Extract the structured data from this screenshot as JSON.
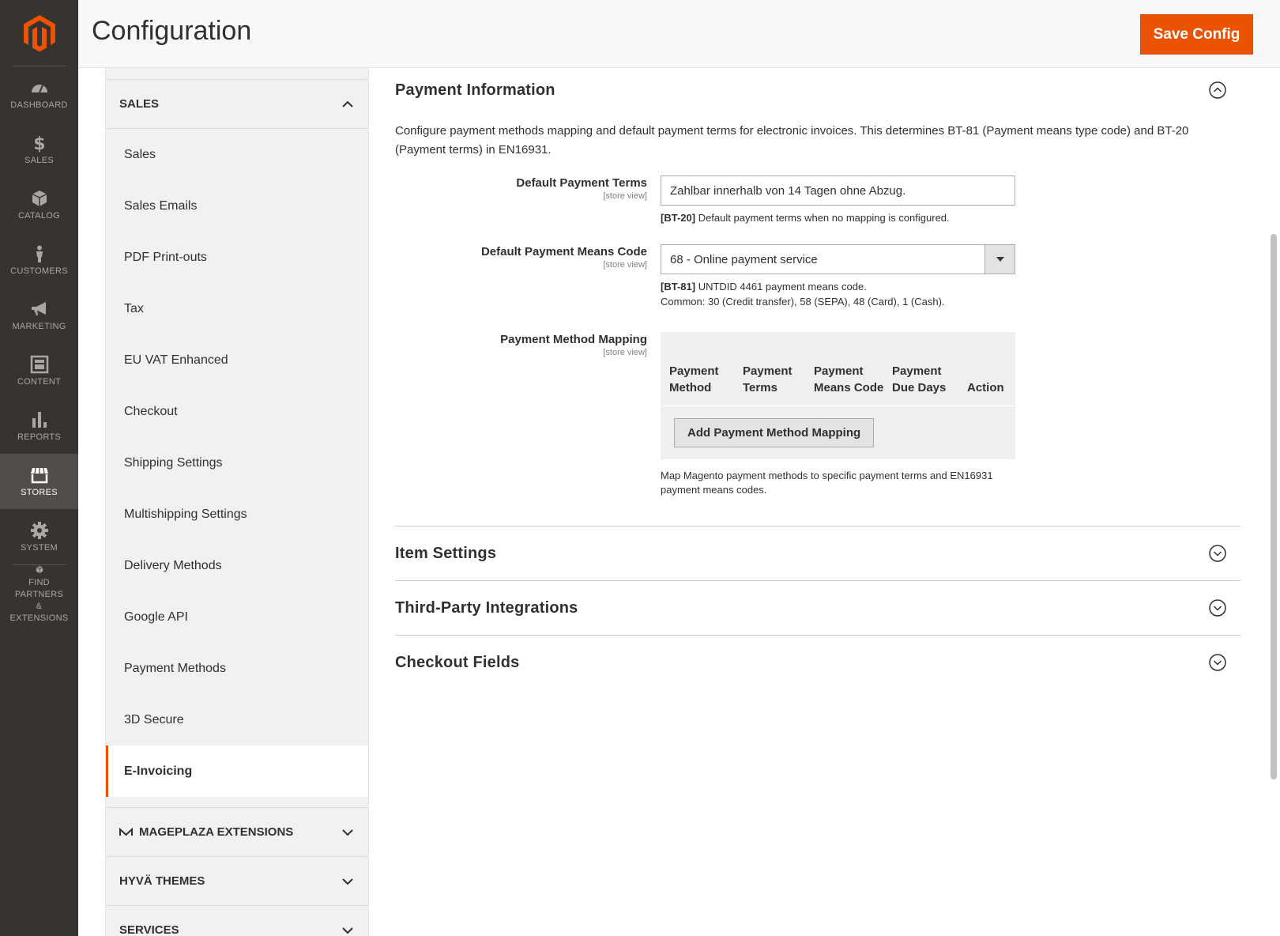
{
  "nav": {
    "items": [
      {
        "label": "DASHBOARD",
        "icon": "dashboard-icon"
      },
      {
        "label": "SALES",
        "icon": "dollar-icon"
      },
      {
        "label": "CATALOG",
        "icon": "box-icon"
      },
      {
        "label": "CUSTOMERS",
        "icon": "person-icon"
      },
      {
        "label": "MARKETING",
        "icon": "megaphone-icon"
      },
      {
        "label": "CONTENT",
        "icon": "layout-icon"
      },
      {
        "label": "REPORTS",
        "icon": "bar-chart-icon"
      },
      {
        "label": "STORES",
        "icon": "store-icon"
      },
      {
        "label": "SYSTEM",
        "icon": "gear-icon"
      }
    ],
    "partners_line1": "FIND PARTNERS",
    "partners_line2": "& EXTENSIONS"
  },
  "header": {
    "title": "Configuration",
    "save_label": "Save Config"
  },
  "tabs": {
    "sales_group": "SALES",
    "sales_items": [
      "Sales",
      "Sales Emails",
      "PDF Print-outs",
      "Tax",
      "EU VAT Enhanced",
      "Checkout",
      "Shipping Settings",
      "Multishipping Settings",
      "Delivery Methods",
      "Google API",
      "Payment Methods",
      "3D Secure",
      "E-Invoicing"
    ],
    "mageplaza_group": "MAGEPLAZA EXTENSIONS",
    "hyva_group": "HYVÄ THEMES",
    "services_group": "SERVICES"
  },
  "payment": {
    "title": "Payment Information",
    "description": "Configure payment methods mapping and default payment terms for electronic invoices. This determines BT-81 (Payment means type code) and BT-20 (Payment terms) in EN16931.",
    "terms_label": "Default Payment Terms",
    "terms_scope": "[store view]",
    "terms_value": "Zahlbar innerhalb von 14 Tagen ohne Abzug.",
    "terms_note_code": "[BT-20]",
    "terms_note_text": "Default payment terms when no mapping is configured.",
    "means_label": "Default Payment Means Code",
    "means_scope": "[store view]",
    "means_value": "68 - Online payment service",
    "means_note_code": "[BT-81]",
    "means_note_text": "UNTDID 4461 payment means code.",
    "means_note_line2": "Common: 30 (Credit transfer), 58 (SEPA), 48 (Card), 1 (Cash).",
    "mapping_label": "Payment Method Mapping",
    "mapping_scope": "[store view]",
    "mapping_columns": [
      "Payment Method",
      "Payment Terms",
      "Payment Means Code",
      "Payment Due Days",
      "Action"
    ],
    "mapping_add": "Add Payment Method Mapping",
    "mapping_note": "Map Magento payment methods to specific payment terms and EN16931 payment means codes."
  },
  "sections": {
    "item_settings": "Item Settings",
    "third_party": "Third-Party Integrations",
    "checkout_fields": "Checkout Fields"
  },
  "colors": {
    "accent": "#eb5202",
    "nav_bg": "#373330",
    "nav_active": "#524d49"
  }
}
